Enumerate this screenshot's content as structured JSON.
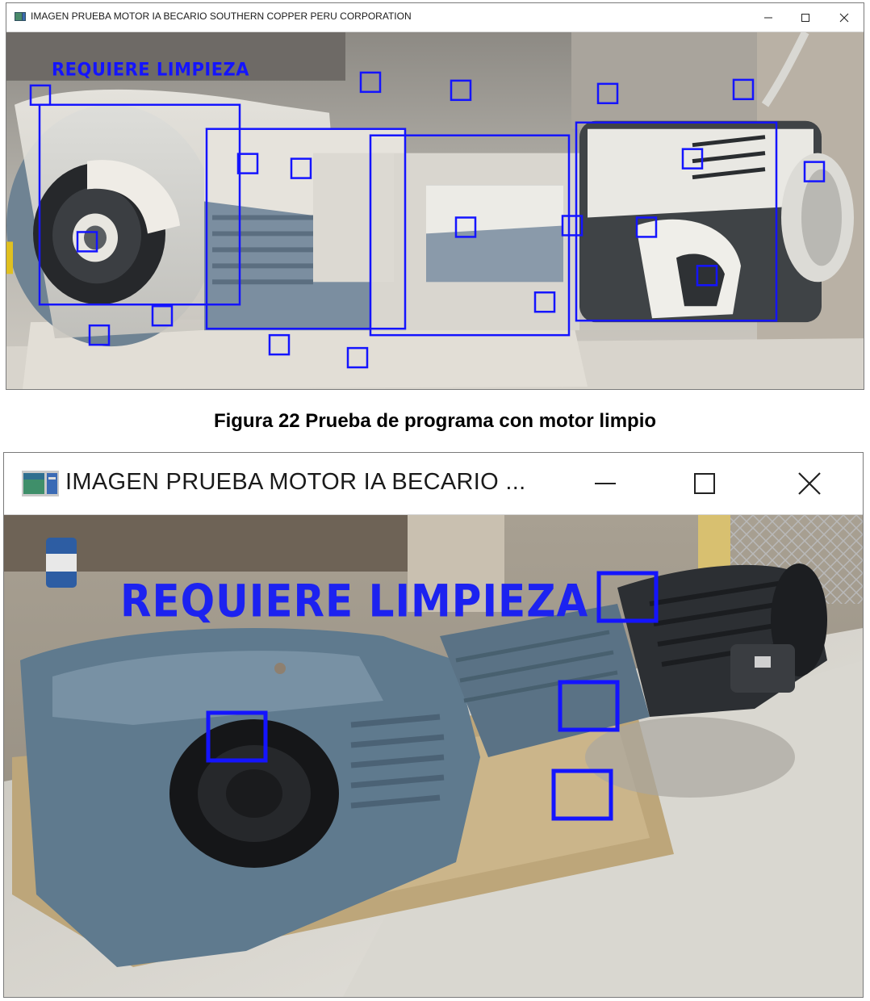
{
  "window1": {
    "title": "IMAGEN PRUEBA MOTOR IA BECARIO SOUTHERN COPPER PERU CORPORATION",
    "overlay_label": "REQUIERE  LIMPIEZA",
    "icons": {
      "app": "app-window-icon",
      "minimize": "minimize-icon",
      "maximize": "maximize-icon",
      "close": "close-icon"
    }
  },
  "caption": "Figura 22 Prueba de programa con motor limpio",
  "window2": {
    "title": "IMAGEN PRUEBA MOTOR IA BECARIO ...",
    "overlay_label": "REQUIERE  LIMPIEZA",
    "icons": {
      "app": "app-window-icon",
      "minimize": "minimize-icon",
      "maximize": "maximize-icon",
      "close": "close-icon"
    }
  },
  "colors": {
    "detection_box": "#1414ff",
    "titlebar": "#ffffff",
    "motor_blue_gray": "#5e7588",
    "dust": "#dcdad3"
  }
}
